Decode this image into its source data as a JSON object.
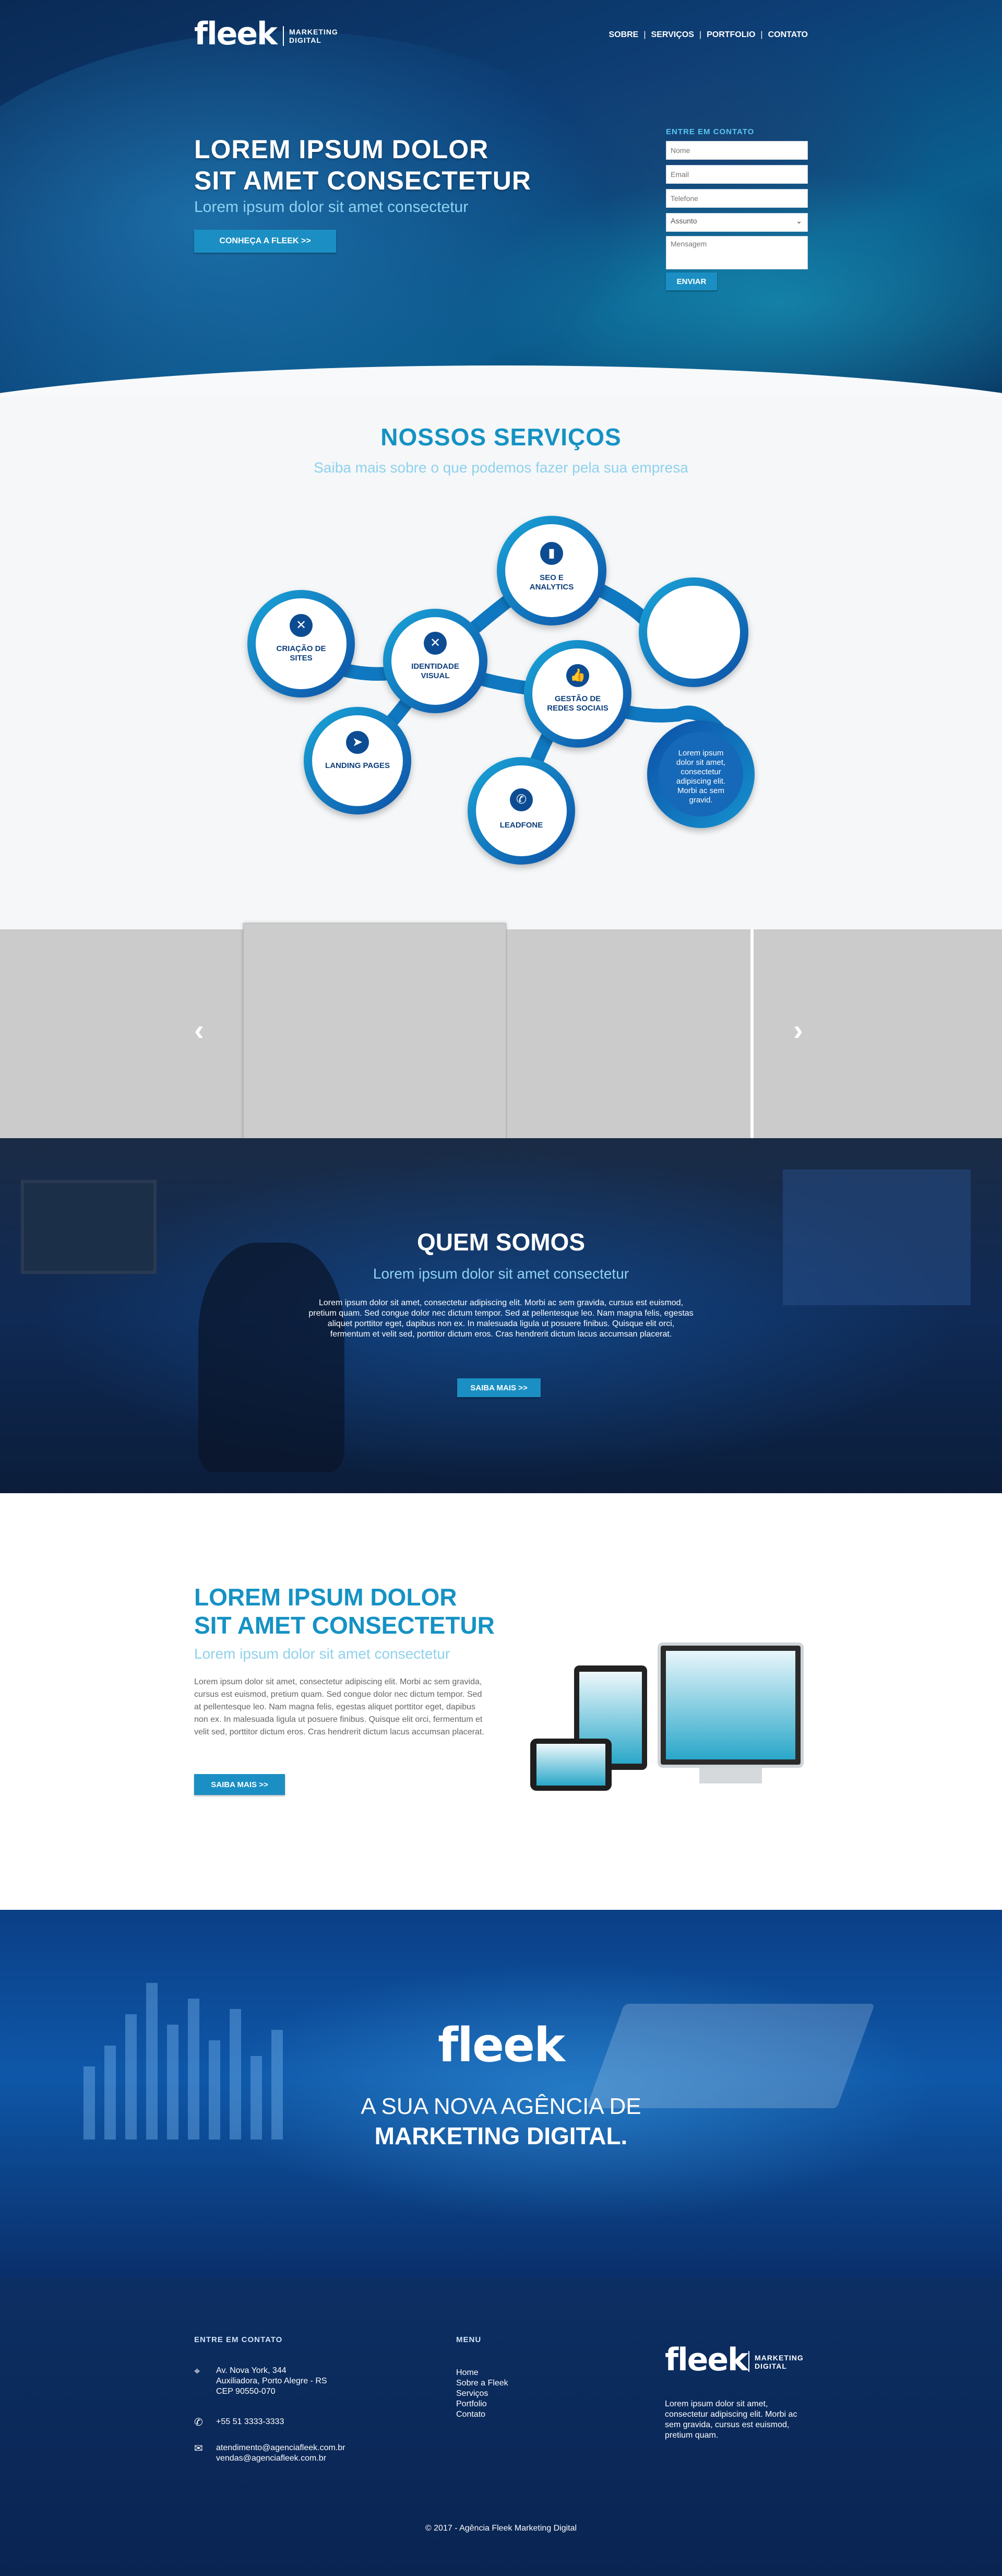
{
  "header": {
    "logo": "fleek",
    "logo_sub_1": "MARKETING",
    "logo_sub_2": "DIGITAL",
    "nav": [
      "SOBRE",
      "SERVIÇOS",
      "PORTFOLIO",
      "CONTATO"
    ]
  },
  "hero": {
    "title_1": "LOREM IPSUM DOLOR",
    "title_2": "SIT AMET CONSECTETUR",
    "subtitle": "Lorem ipsum dolor sit amet consectetur",
    "cta": "CONHEÇA A FLEEK >>",
    "form": {
      "label": "ENTRE EM CONTATO",
      "nome": "Nome",
      "email": "Email",
      "telefone": "Telefone",
      "assunto": "Assunto",
      "mensagem": "Mensagem",
      "submit": "ENVIAR"
    }
  },
  "services": {
    "title": "NOSSOS SERVIÇOS",
    "subtitle": "Saiba mais sobre o que podemos fazer pela sua empresa",
    "nodes": {
      "criacao": "CRIAÇÃO DE SITES",
      "identidade": "IDENTIDADE VISUAL",
      "seo": "SEO E ANALYTICS",
      "redes": "GESTÃO DE REDES SOCIAIS",
      "landing": "LANDING PAGES",
      "leadfone": "LEADFONE",
      "lorem": "Lorem ipsum dolor sit amet, consectetur adipiscing elit. Morbi ac sem gravid."
    },
    "icons": {
      "criacao": "code-icon",
      "identidade": "tools-icon",
      "seo": "chart-icon",
      "redes": "like-icon",
      "landing": "cursor-icon",
      "leadfone": "phone-icon"
    }
  },
  "carousel": {
    "prev": "‹",
    "next": "›"
  },
  "quem": {
    "title": "QUEM SOMOS",
    "subtitle": "Lorem ipsum dolor sit amet consectetur",
    "text": "Lorem ipsum dolor sit amet, consectetur adipiscing elit. Morbi ac sem gravida, cursus est euismod, pretium quam. Sed congue dolor nec dictum tempor. Sed at pellentesque leo. Nam magna felis, egestas aliquet porttitor eget, dapibus non ex. In malesuada ligula ut posuere finibus. Quisque elit orci, fermentum et velit sed, porttitor dictum eros. Cras hendrerit dictum lacus accumsan placerat.",
    "button": "SAIBA MAIS >>"
  },
  "lorem": {
    "title_1": "LOREM IPSUM DOLOR",
    "title_2": "SIT AMET CONSECTETUR",
    "subtitle": "Lorem ipsum dolor sit amet consectetur",
    "text": "Lorem ipsum dolor sit amet, consectetur adipiscing elit. Morbi ac sem gravida, cursus est euismod, pretium quam. Sed congue dolor nec dictum tempor. Sed at pellentesque leo. Nam magna felis, egestas aliquet porttitor eget, dapibus non ex. In malesuada ligula ut posuere finibus. Quisque elit orci, fermentum et velit sed, porttitor dictum eros. Cras hendrerit dictum lacus accumsan placerat.",
    "button": "SAIBA MAIS >>"
  },
  "banner": {
    "logo": "fleek",
    "line_1": "A SUA NOVA AGÊNCIA DE",
    "line_2": "MARKETING DIGITAL."
  },
  "footer": {
    "contact_head": "ENTRE EM CONTATO",
    "address": [
      "Av. Nova York, 344",
      "Auxiliadora, Porto Alegre - RS",
      "CEP 90550-070"
    ],
    "phone": "+55 51 3333-3333",
    "emails": [
      "atendimento@agenciafleek.com.br",
      "vendas@agenciafleek.com.br"
    ],
    "menu_head": "MENU",
    "menu": [
      "Home",
      "Sobre a Fleek",
      "Serviços",
      "Portfolio",
      "Contato"
    ],
    "logo": "fleek",
    "logo_sub_1": "MARKETING",
    "logo_sub_2": "DIGITAL",
    "about": "Lorem ipsum dolor sit amet, consectetur adipiscing elit. Morbi ac sem gravida, cursus est euismod, pretium quam.",
    "copyright": "© 2017 - Agência Fleek Marketing Digital"
  },
  "colors": {
    "accent": "#1592c4",
    "accent_light": "#8fd1ec",
    "navy": "#0c2f63"
  }
}
